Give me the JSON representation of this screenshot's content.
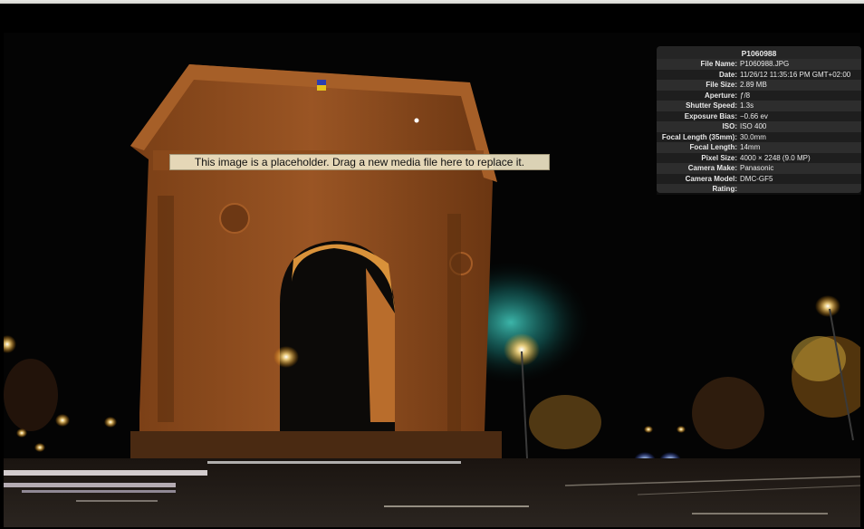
{
  "placeholder": {
    "message": "This image is a placeholder. Drag a new media file here to replace it."
  },
  "info_panel": {
    "title": "P1060988",
    "rows": [
      {
        "label": "File Name:",
        "value": "P1060988.JPG"
      },
      {
        "label": "Date:",
        "value": "11/26/12 11:35:16 PM GMT+02:00"
      },
      {
        "label": "File Size:",
        "value": "2.89 MB"
      },
      {
        "label": "Aperture:",
        "value": "ƒ/8"
      },
      {
        "label": "Shutter Speed:",
        "value": "1.3s"
      },
      {
        "label": "Exposure Bias:",
        "value": "−0.66 ev"
      },
      {
        "label": "ISO:",
        "value": "ISO 400"
      },
      {
        "label": "Focal Length (35mm):",
        "value": "30.0mm"
      },
      {
        "label": "Focal Length:",
        "value": "14mm"
      },
      {
        "label": "Pixel Size:",
        "value": "4000 × 2248 (9.0 MP)"
      },
      {
        "label": "Camera Make:",
        "value": "Panasonic"
      },
      {
        "label": "Camera Model:",
        "value": "DMC-GF5"
      },
      {
        "label": "Rating:",
        "value": ""
      }
    ]
  },
  "colors": {
    "arch": "#8a4a1c",
    "arch_highlight": "#c8752e",
    "night_sky": "#050505",
    "street_light": "#ffd27a",
    "cyan_glow": "#2fd6c8"
  }
}
